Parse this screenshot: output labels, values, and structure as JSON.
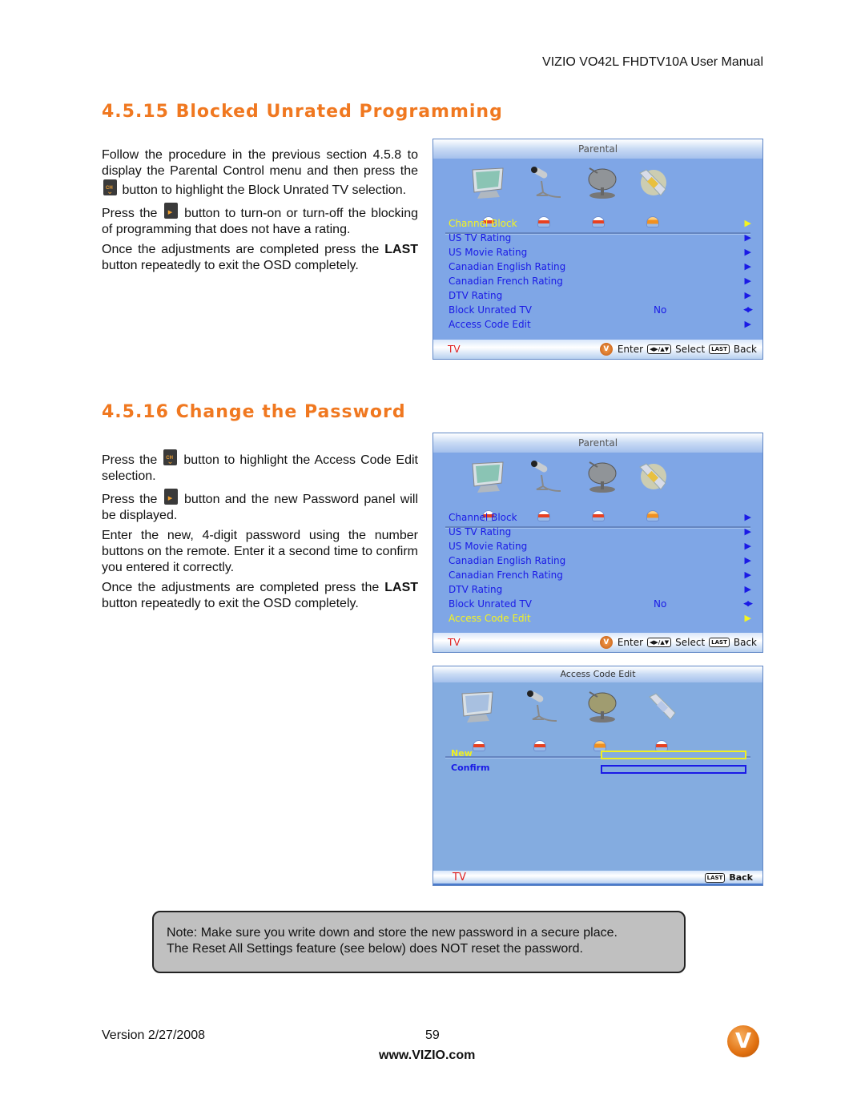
{
  "header": {
    "running_title": "VIZIO VO42L FHDTV10A User Manual"
  },
  "sections": [
    {
      "title": "4.5.15 Blocked Unrated Programming",
      "paragraphs": {
        "p1_before": "Follow the procedure in the previous section 4.5.8 to display the Parental Control menu and then press the",
        "p1_after": "button to highlight the Block Unrated TV selection.",
        "p2_before": "Press the",
        "p2_after": "button to turn-on or turn-off the blocking of programming that does not have a rating.",
        "p3_bold": "LAST",
        "p3_before": "Once the adjustments are completed press the",
        "p3_after": "button repeatedly to exit the OSD completely."
      }
    },
    {
      "title": "4.5.16 Change the Password",
      "paragraphs": {
        "p1_before": "Press the",
        "p1_after": "button to highlight the Access Code Edit selection.",
        "p2_before": "Press the",
        "p2_after": "button and the new Password panel will be displayed.",
        "p3": "Enter the new, 4-digit password using the number buttons on the remote.  Enter it a second time to confirm you entered it correctly.",
        "p4_before": "Once the adjustments are completed press the",
        "p4_bold": "LAST",
        "p4_after": "button repeatedly to exit the OSD completely."
      }
    }
  ],
  "icons": {
    "remote_ch_button": "channel-down-button-icon",
    "remote_vol_button": "volume-right-button-icon",
    "osd_tabs": [
      "tv-picture-icon",
      "audio-microphone-icon",
      "satellite-dish-tuner-icon",
      "wrench-setup-icon"
    ]
  },
  "osd_parental_1": {
    "title": "Parental",
    "active_tab": 3,
    "selected_index": 0,
    "items": [
      {
        "label": "Channel Block",
        "value": "",
        "arrow": "▶"
      },
      {
        "label": "US TV Rating",
        "value": "",
        "arrow": "▶"
      },
      {
        "label": "US Movie Rating",
        "value": "",
        "arrow": "▶"
      },
      {
        "label": "Canadian English Rating",
        "value": "",
        "arrow": "▶"
      },
      {
        "label": "Canadian French Rating",
        "value": "",
        "arrow": "▶"
      },
      {
        "label": "DTV Rating",
        "value": "",
        "arrow": "▶"
      },
      {
        "label": "Block Unrated TV",
        "value": "No",
        "arrow": "◀▶"
      },
      {
        "label": "Access Code Edit",
        "value": "",
        "arrow": "▶"
      }
    ],
    "footer": {
      "source": "TV",
      "enter_label": "Enter",
      "select_key": "◀▶/▲▼",
      "select_label": "Select",
      "back_key": "LAST",
      "back_label": "Back"
    }
  },
  "osd_parental_2": {
    "title": "Parental",
    "active_tab": 3,
    "selected_index": 7,
    "items": [
      {
        "label": "Channel Block",
        "value": "",
        "arrow": "▶"
      },
      {
        "label": "US TV Rating",
        "value": "",
        "arrow": "▶"
      },
      {
        "label": "US Movie Rating",
        "value": "",
        "arrow": "▶"
      },
      {
        "label": "Canadian English Rating",
        "value": "",
        "arrow": "▶"
      },
      {
        "label": "Canadian French Rating",
        "value": "",
        "arrow": "▶"
      },
      {
        "label": "DTV Rating",
        "value": "",
        "arrow": "▶"
      },
      {
        "label": "Block Unrated TV",
        "value": "No",
        "arrow": "◀▶"
      },
      {
        "label": "Access Code Edit",
        "value": "",
        "arrow": "▶"
      }
    ],
    "footer": {
      "source": "TV",
      "enter_label": "Enter",
      "select_key": "◀▶/▲▼",
      "select_label": "Select",
      "back_key": "LAST",
      "back_label": "Back"
    }
  },
  "osd_access_code": {
    "title": "Access Code Edit",
    "active_tab": 2,
    "new_label": "New",
    "new_value": "",
    "confirm_label": "Confirm",
    "confirm_value": "",
    "footer": {
      "source": "TV",
      "back_key": "LAST",
      "back_label": "Back"
    }
  },
  "colors": {
    "heading_orange": "#f07820",
    "osd_blue": "#7fa6e6",
    "osd_item_text": "#1a1ae6",
    "osd_selected_text": "#f4f420",
    "osd_source_red": "#e02020"
  },
  "note": {
    "line1": "Note: Make sure you write down and store the new password in a secure place.",
    "line2": "The Reset All Settings feature (see below) does NOT reset the password."
  },
  "footer": {
    "version": "Version 2/27/2008",
    "page_number": "59",
    "url": "www.VIZIO.com",
    "logo_letter": "V"
  }
}
